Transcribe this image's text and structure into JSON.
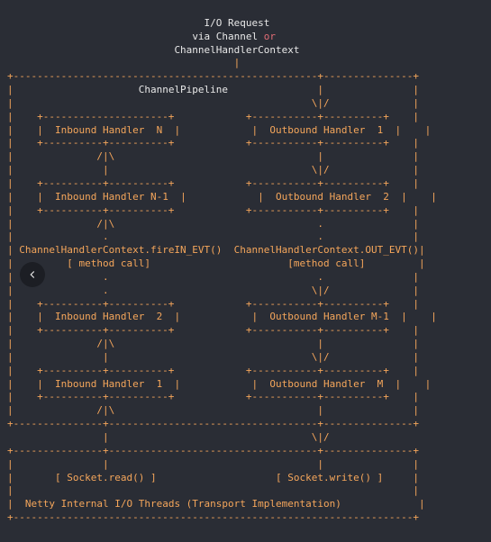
{
  "header": {
    "line1": "I/O Request",
    "line2_pre": "via Channel ",
    "line2_or": "or",
    "line2_post": "",
    "line3": "ChannelHandlerContext"
  },
  "pipeline": {
    "title": "ChannelPipeline",
    "inboundN": "Inbound Handler  N",
    "inboundN1": "Inbound Handler N-1",
    "inbound2": "Inbound Handler  2",
    "inbound1": "Inbound Handler  1",
    "outbound1": "Outbound Handler  1",
    "outbound2": "Outbound Handler  2",
    "outboundM1": "Outbound Handler M-1",
    "outboundM": "Outbound Handler  M",
    "ctxFireIn": "ChannelHandlerContext.fireIN_EVT()",
    "ctxOutEvt": "ChannelHandlerContext.OUT_EVT()",
    "methodCallL": "[ method call]",
    "methodCallR": "[method call]"
  },
  "footer": {
    "socketRead": "[ Socket.read() ]",
    "socketWrite": "[ Socket.write() ]",
    "threads": "Netty Internal I/O Threads (Transport Implementation)"
  }
}
